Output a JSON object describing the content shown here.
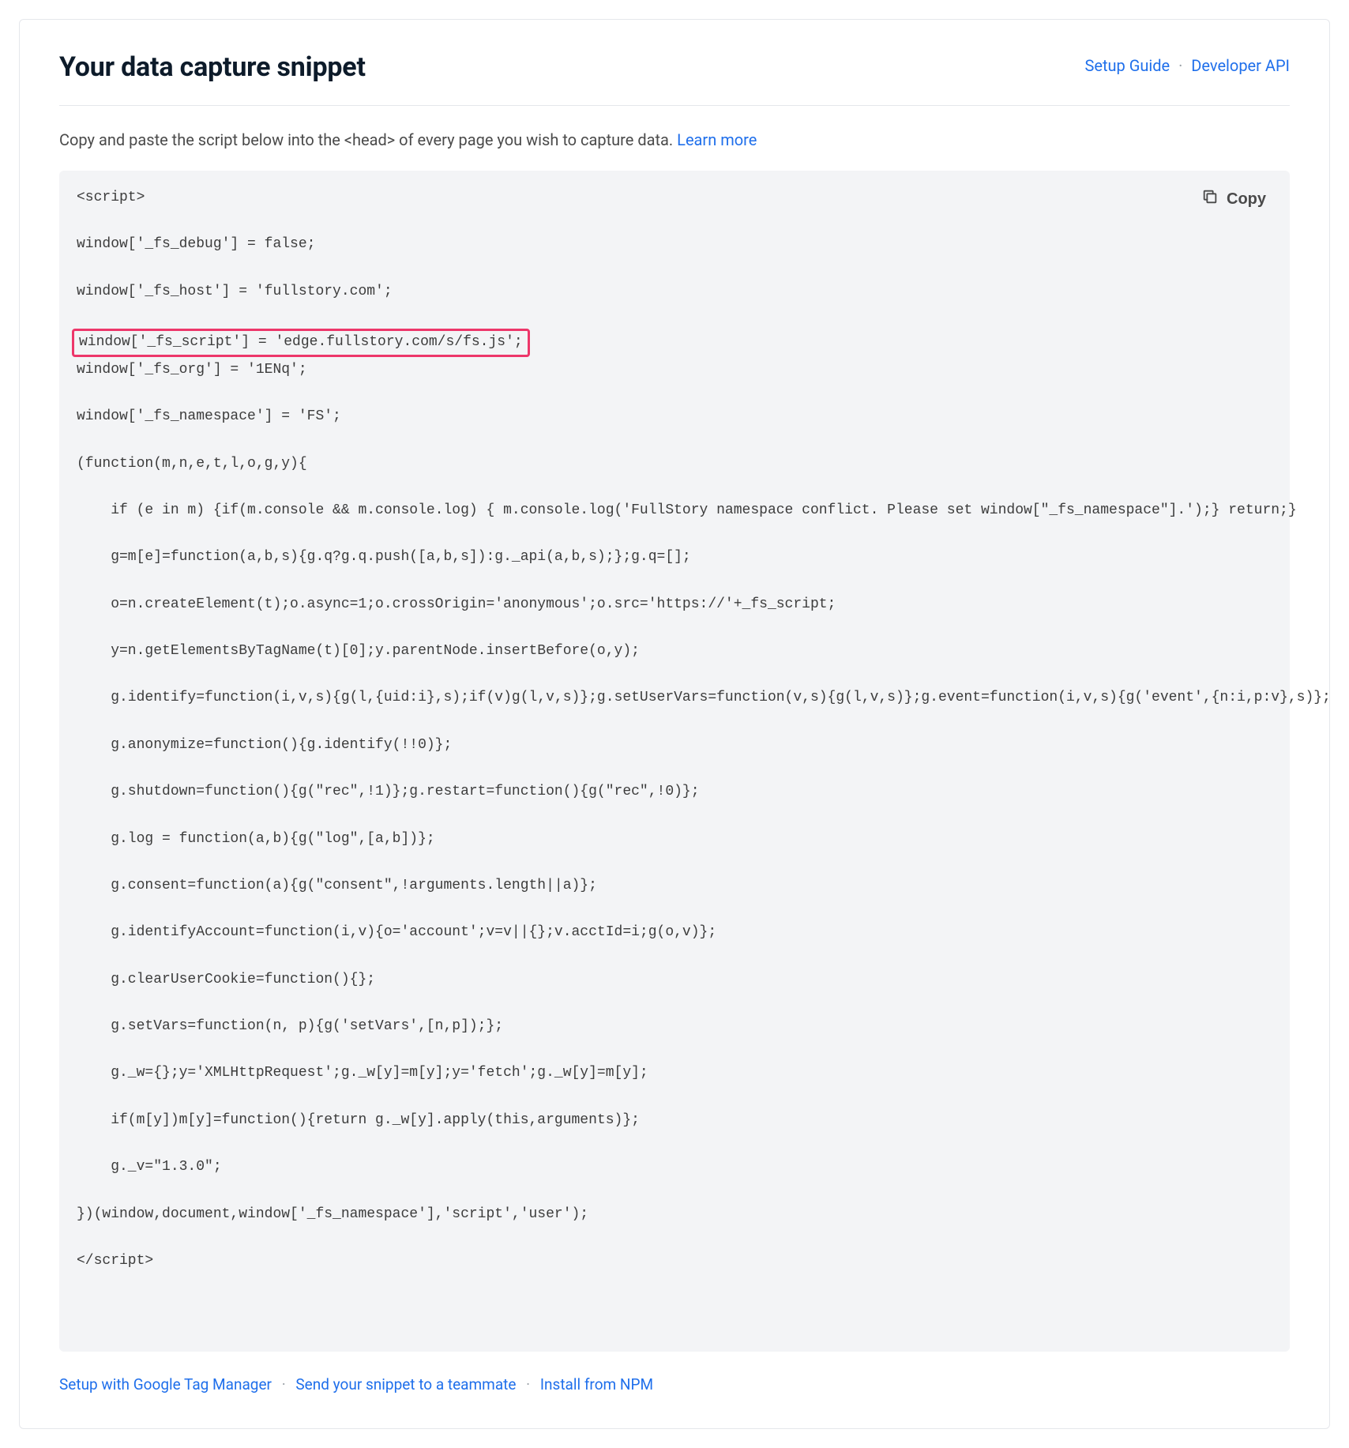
{
  "header": {
    "title": "Your data capture snippet",
    "links": {
      "setup_guide": "Setup Guide",
      "developer_api": "Developer API"
    }
  },
  "instructions": {
    "text_before": "Copy and paste the script below into the <head> of every page you wish to capture data. ",
    "learn_more": "Learn more"
  },
  "copy_button": {
    "label": "Copy"
  },
  "code": {
    "lines": [
      {
        "text": "<script>",
        "highlighted": false,
        "indent": 0
      },
      {
        "text": "window['_fs_debug'] = false;",
        "highlighted": false,
        "indent": 0
      },
      {
        "text": "window['_fs_host'] = 'fullstory.com';",
        "highlighted": false,
        "indent": 0
      },
      {
        "text": "window['_fs_script'] = 'edge.fullstory.com/s/fs.js';",
        "highlighted": true,
        "indent": 0
      },
      {
        "text": "window['_fs_org'] = '1ENq';",
        "highlighted": false,
        "indent": 0
      },
      {
        "text": "window['_fs_namespace'] = 'FS';",
        "highlighted": false,
        "indent": 0
      },
      {
        "text": "(function(m,n,e,t,l,o,g,y){",
        "highlighted": false,
        "indent": 0
      },
      {
        "text": "if (e in m) {if(m.console && m.console.log) { m.console.log('FullStory namespace conflict. Please set window[\"_fs_namespace\"].');} return;}",
        "highlighted": false,
        "indent": 1
      },
      {
        "text": "g=m[e]=function(a,b,s){g.q?g.q.push([a,b,s]):g._api(a,b,s);};g.q=[];",
        "highlighted": false,
        "indent": 1
      },
      {
        "text": "o=n.createElement(t);o.async=1;o.crossOrigin='anonymous';o.src='https://'+_fs_script;",
        "highlighted": false,
        "indent": 1
      },
      {
        "text": "y=n.getElementsByTagName(t)[0];y.parentNode.insertBefore(o,y);",
        "highlighted": false,
        "indent": 1
      },
      {
        "text": "g.identify=function(i,v,s){g(l,{uid:i},s);if(v)g(l,v,s)};g.setUserVars=function(v,s){g(l,v,s)};g.event=function(i,v,s){g('event',{n:i,p:v},s)};",
        "highlighted": false,
        "indent": 1
      },
      {
        "text": "g.anonymize=function(){g.identify(!!0)};",
        "highlighted": false,
        "indent": 1
      },
      {
        "text": "g.shutdown=function(){g(\"rec\",!1)};g.restart=function(){g(\"rec\",!0)};",
        "highlighted": false,
        "indent": 1
      },
      {
        "text": "g.log = function(a,b){g(\"log\",[a,b])};",
        "highlighted": false,
        "indent": 1
      },
      {
        "text": "g.consent=function(a){g(\"consent\",!arguments.length||a)};",
        "highlighted": false,
        "indent": 1
      },
      {
        "text": "g.identifyAccount=function(i,v){o='account';v=v||{};v.acctId=i;g(o,v)};",
        "highlighted": false,
        "indent": 1
      },
      {
        "text": "g.clearUserCookie=function(){};",
        "highlighted": false,
        "indent": 1
      },
      {
        "text": "g.setVars=function(n, p){g('setVars',[n,p]);};",
        "highlighted": false,
        "indent": 1
      },
      {
        "text": "g._w={};y='XMLHttpRequest';g._w[y]=m[y];y='fetch';g._w[y]=m[y];",
        "highlighted": false,
        "indent": 1
      },
      {
        "text": "if(m[y])m[y]=function(){return g._w[y].apply(this,arguments)};",
        "highlighted": false,
        "indent": 1
      },
      {
        "text": "g._v=\"1.3.0\";",
        "highlighted": false,
        "indent": 1
      },
      {
        "text": "})(window,document,window['_fs_namespace'],'script','user');",
        "highlighted": false,
        "indent": 0
      },
      {
        "text": "</script>",
        "highlighted": false,
        "indent": 0
      }
    ]
  },
  "footer_links": {
    "gtm": "Setup with Google Tag Manager",
    "send": "Send your snippet to a teammate",
    "npm": "Install from NPM"
  },
  "colors": {
    "link_blue": "#1f6feb",
    "highlight_pink": "#ed376a"
  }
}
